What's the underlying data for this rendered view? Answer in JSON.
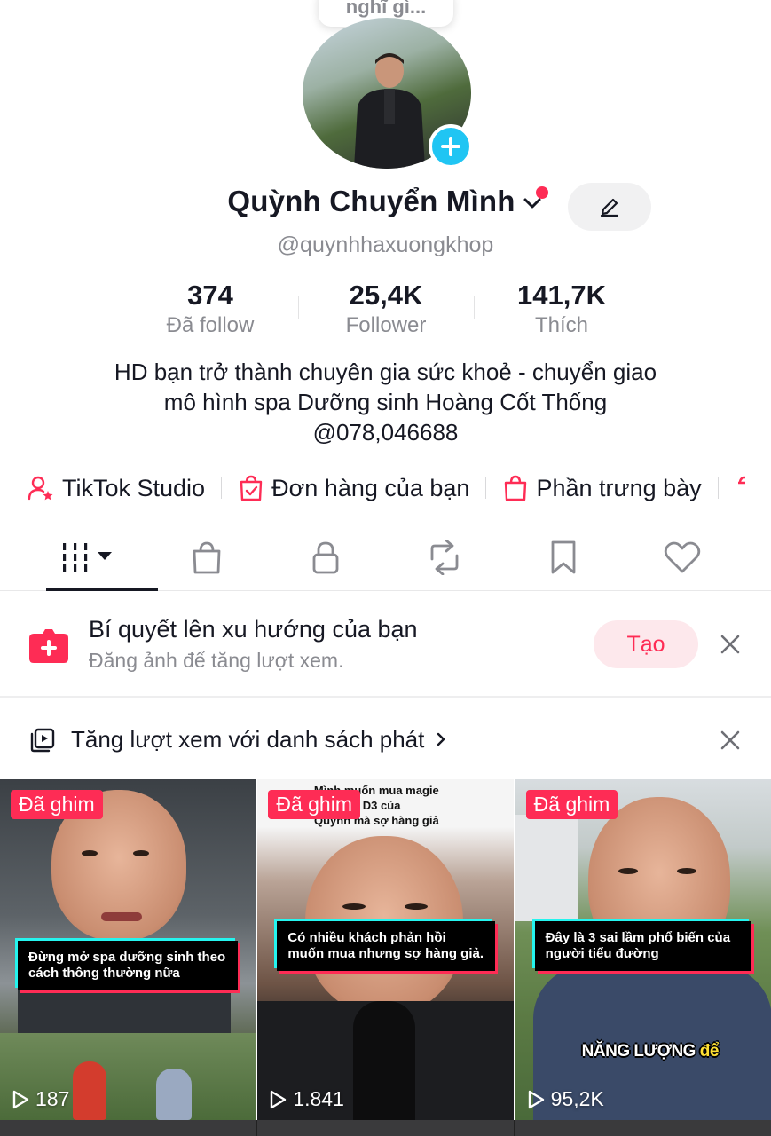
{
  "note": {
    "text": "nghĩ gì..."
  },
  "profile": {
    "name": "Quỳnh Chuyển Mình",
    "handle": "@quynhhaxuongkhop",
    "bio_lines": [
      "HD bạn trở thành chuyên gia sức khoẻ - chuyển giao",
      "mô hình spa Dưỡng sinh Hoàng Cốt Thống",
      "@078,046688"
    ]
  },
  "stats": [
    {
      "value": "374",
      "label": "Đã follow"
    },
    {
      "value": "25,4K",
      "label": "Follower"
    },
    {
      "value": "141,7K",
      "label": "Thích"
    }
  ],
  "links": [
    {
      "label": "TikTok Studio",
      "icon": "person-star-icon"
    },
    {
      "label": "Đơn hàng của bạn",
      "icon": "order-bag-icon"
    },
    {
      "label": "Phần trưng bày",
      "icon": "shopping-bag-icon"
    }
  ],
  "tabs": [
    "videos-grid-icon",
    "shop-bag-icon",
    "lock-icon",
    "repost-icon",
    "bookmark-icon",
    "heart-icon"
  ],
  "trend": {
    "title": "Bí quyết lên xu hướng của bạn",
    "subtitle": "Đăng ảnh để tăng lượt xem.",
    "button": "Tạo"
  },
  "playlist": {
    "text": "Tăng lượt xem với danh sách phát"
  },
  "videos": [
    {
      "pinned": "Đã ghim",
      "caption": "Đừng mở spa dưỡng sinh theo cách thông thường nữa",
      "views": "187"
    },
    {
      "pinned": "Đã ghim",
      "top_caption": "Mình muốn mua magie\nn D3 của\nQuỳnh mà sợ hàng giả",
      "caption": "Có nhiều khách phản hồi muốn mua nhưng sợ hàng giả.",
      "views": "1.841"
    },
    {
      "pinned": "Đã ghim",
      "caption": "Đây là 3 sai lầm phổ biến của người tiểu đường",
      "overlay_a": "NĂNG LƯỢNG ",
      "overlay_b": "để",
      "views": "95,2K"
    }
  ],
  "colors": {
    "accent": "#fe2c55",
    "add_button": "#20c5f3"
  }
}
